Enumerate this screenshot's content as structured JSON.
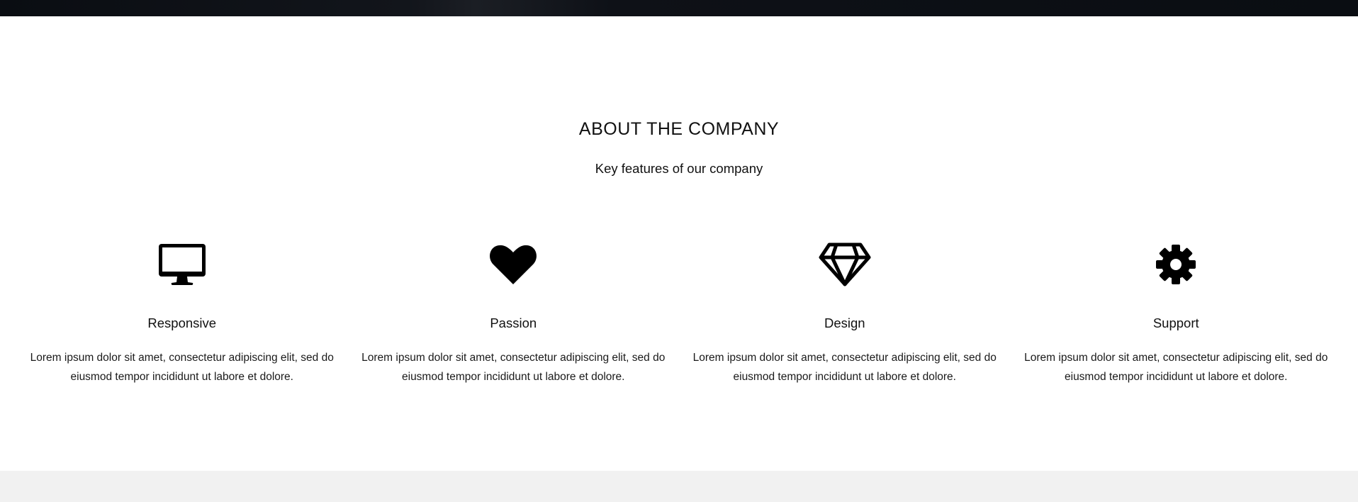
{
  "about": {
    "heading": "ABOUT THE COMPANY",
    "subheading": "Key features of our company",
    "features": [
      {
        "icon": "monitor-icon",
        "title": "Responsive",
        "text": "Lorem ipsum dolor sit amet, consectetur adipiscing elit, sed do eiusmod tempor incididunt ut labore et dolore."
      },
      {
        "icon": "heart-icon",
        "title": "Passion",
        "text": "Lorem ipsum dolor sit amet, consectetur adipiscing elit, sed do eiusmod tempor incididunt ut labore et dolore."
      },
      {
        "icon": "diamond-icon",
        "title": "Design",
        "text": "Lorem ipsum dolor sit amet, consectetur adipiscing elit, sed do eiusmod tempor incididunt ut labore et dolore."
      },
      {
        "icon": "gear-icon",
        "title": "Support",
        "text": "Lorem ipsum dolor sit amet, consectetur adipiscing elit, sed do eiusmod tempor incididunt ut labore et dolore."
      }
    ]
  },
  "colors": {
    "text": "#111111",
    "background": "#ffffff",
    "top_band": "#0a0d12",
    "footer_band": "#f1f1f1"
  }
}
